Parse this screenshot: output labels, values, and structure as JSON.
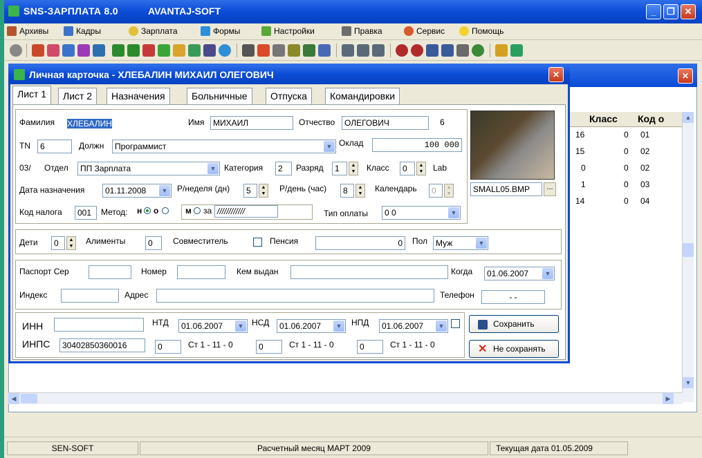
{
  "app": {
    "title": "SNS-ЗАРПЛАТА 8.0",
    "vendor": "AVANTAJ-SOFT"
  },
  "menu": [
    "Архивы",
    "Кадры",
    "Зарплата",
    "Формы",
    "Настройки",
    "Правка",
    "Сервис",
    "Помощь"
  ],
  "grid": {
    "headers": [
      "Класс",
      "Код о"
    ],
    "rows": [
      {
        "a": "16",
        "klass": "0",
        "kod": "01"
      },
      {
        "a": "15",
        "klass": "0",
        "kod": "02"
      },
      {
        "a": "0",
        "klass": "0",
        "kod": "02"
      },
      {
        "a": "1",
        "klass": "0",
        "kod": "03"
      },
      {
        "a": "14",
        "klass": "0",
        "kod": "04"
      }
    ]
  },
  "dialog": {
    "title": "Личная карточка - ХЛЕБАЛИН МИХАИЛ ОЛЕГОВИЧ",
    "tabs": [
      "Лист 1",
      "Лист 2",
      "Назначения",
      "Больничные",
      "Отпуска",
      "Командировки"
    ],
    "lastname_label": "Фамилия",
    "lastname": "ХЛЕБАЛИН",
    "firstname_label": "Имя",
    "firstname": "МИХАИЛ",
    "patronymic_label": "Отчество",
    "patronymic": "ОЛЕГОВИЧ",
    "count": "6",
    "tn_label": "TN",
    "tn": "6",
    "position_label": "Должн",
    "position": "Программист",
    "salary_label": "Оклад",
    "salary": "100 000",
    "dept_code": "03/",
    "dept_label": "Отдел",
    "dept": "ПП Зарплата",
    "category_label": "Категория",
    "category": "2",
    "grade_label": "Разряд",
    "grade": "1",
    "class_label": "Класс",
    "class": "0",
    "lab_label": "Lab",
    "photo_file": "SMALL05.BMP",
    "photo_btn": "...",
    "hire_label": "Дата назначения",
    "hire_date": "01.11.2008",
    "days_week_label": "Р/неделя (дн)",
    "days_week": "5",
    "hours_day_label": "Р/день (час)",
    "hours_day": "8",
    "calendar_label": "Календарь",
    "calendar": "0",
    "tax_label": "Код налога",
    "tax_code": "001",
    "method_label": "Метод:",
    "method_n": "н",
    "method_o": "о",
    "method_m": "м",
    "method_za": "за",
    "method_value": "////////////",
    "pay_type_label": "Тип оплаты",
    "pay_type": "0  0",
    "children_label": "Дети",
    "children": "0",
    "alimony_label": "Алименты",
    "alimony": "0",
    "parttime_label": "Совместитель",
    "pension_label": "Пенсия",
    "pension": "0",
    "gender_label": "Пол",
    "gender": "Муж",
    "passport_label": "Паспорт Сер",
    "number_label": "Номер",
    "issued_label": "Кем выдан",
    "when_label": "Когда",
    "when": "01.06.2007",
    "index_label": "Индекс",
    "address_label": "Адрес",
    "phone_label": "Телефон",
    "phone": "-   -",
    "inn_label": "ИНН",
    "ntd_label": "НТД",
    "ntd": "01.06.2007",
    "nsd_label": "НСД",
    "nsd": "01.06.2007",
    "npd_label": "НПД",
    "npd": "01.06.2007",
    "inps_label": "ИНПС",
    "inps": "30402850360016",
    "st1_val": "0",
    "st1": "Ст 1 - 11 - 0",
    "st2_val": "0",
    "st2": "Ст 1 - 11 - 0",
    "st3_val": "0",
    "st3": "Ст 1 - 11 - 0",
    "save_btn": "Сохранить",
    "nosave_btn": "Не сохранять"
  },
  "status": {
    "left": "SEN-SOFT",
    "month": "Расчетный месяц   МАРТ 2009",
    "date": "Текущая дата   01.05.2009"
  }
}
